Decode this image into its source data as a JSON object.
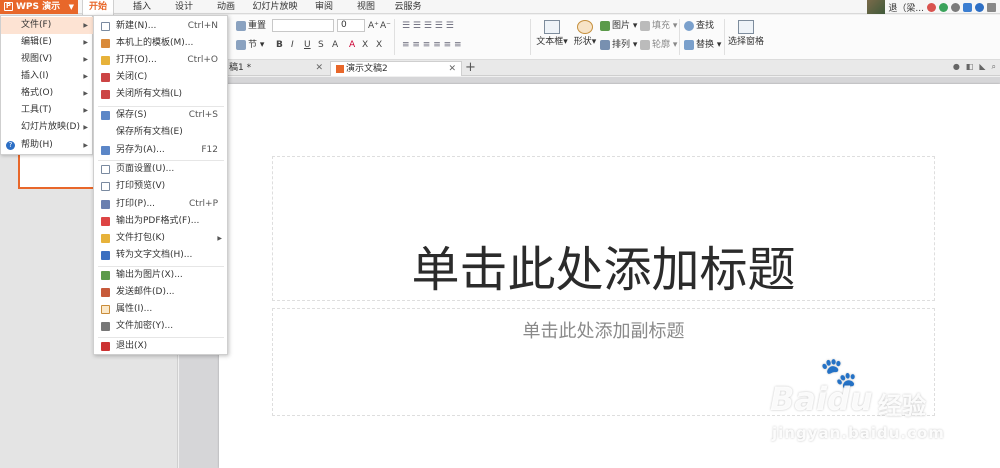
{
  "app": {
    "name": "WPS 演示",
    "logo_letter": "P"
  },
  "tabs": [
    "开始",
    "插入",
    "设计",
    "动画",
    "幻灯片放映",
    "审阅",
    "视图",
    "云服务"
  ],
  "user": {
    "name": "退（梁..."
  },
  "ribbon": {
    "reset": "重置",
    "section": "节",
    "font_size": "0",
    "textbox": "文本框",
    "shape": "形状",
    "picture": "图片",
    "arrange": "排列",
    "fill": "填充",
    "outline": "轮廓",
    "find": "查找",
    "replace": "替换",
    "select_pane": "选择窗格",
    "fmt": [
      "B",
      "I",
      "U",
      "S",
      "A",
      "A",
      "X",
      "X"
    ]
  },
  "doc_tabs": [
    {
      "label": "稿1 *"
    },
    {
      "label": "演示文稿2"
    }
  ],
  "file_menu_parent": [
    {
      "label": "文件(F)",
      "has_sub": true
    },
    {
      "label": "编辑(E)",
      "has_sub": true
    },
    {
      "label": "视图(V)",
      "has_sub": true
    },
    {
      "label": "插入(I)",
      "has_sub": true
    },
    {
      "label": "格式(O)",
      "has_sub": true
    },
    {
      "label": "工具(T)",
      "has_sub": true
    },
    {
      "label": "幻灯片放映(D)",
      "has_sub": true
    },
    {
      "label": "帮助(H)",
      "has_sub": true
    }
  ],
  "file_menu": [
    {
      "label": "新建(N)...",
      "shortcut": "Ctrl+N"
    },
    {
      "label": "本机上的模板(M)...",
      "shortcut": ""
    },
    {
      "label": "打开(O)...",
      "shortcut": "Ctrl+O"
    },
    {
      "label": "关闭(C)",
      "shortcut": ""
    },
    {
      "label": "关闭所有文档(L)",
      "shortcut": ""
    },
    {
      "label": "保存(S)",
      "shortcut": "Ctrl+S"
    },
    {
      "label": "保存所有文档(E)",
      "shortcut": ""
    },
    {
      "label": "另存为(A)...",
      "shortcut": "F12"
    },
    {
      "label": "页面设置(U)...",
      "shortcut": ""
    },
    {
      "label": "打印预览(V)",
      "shortcut": ""
    },
    {
      "label": "打印(P)...",
      "shortcut": "Ctrl+P"
    },
    {
      "label": "输出为PDF格式(F)...",
      "shortcut": ""
    },
    {
      "label": "文件打包(K)",
      "shortcut": ""
    },
    {
      "label": "转为文字文档(H)...",
      "shortcut": ""
    },
    {
      "label": "输出为图片(X)...",
      "shortcut": ""
    },
    {
      "label": "发送邮件(D)...",
      "shortcut": ""
    },
    {
      "label": "属性(I)...",
      "shortcut": ""
    },
    {
      "label": "文件加密(Y)...",
      "shortcut": ""
    },
    {
      "label": "退出(X)",
      "shortcut": ""
    }
  ],
  "slide": {
    "title_placeholder": "单击此处添加标题",
    "subtitle_placeholder": "单击此处添加副标题"
  },
  "watermark": {
    "brand": "Bai",
    "brand2": "du",
    "cn": "经验",
    "url": "jingyan.baidu.com"
  },
  "colors": {
    "accent": "#e8672a",
    "menu_highlight": "#fde3d3"
  }
}
